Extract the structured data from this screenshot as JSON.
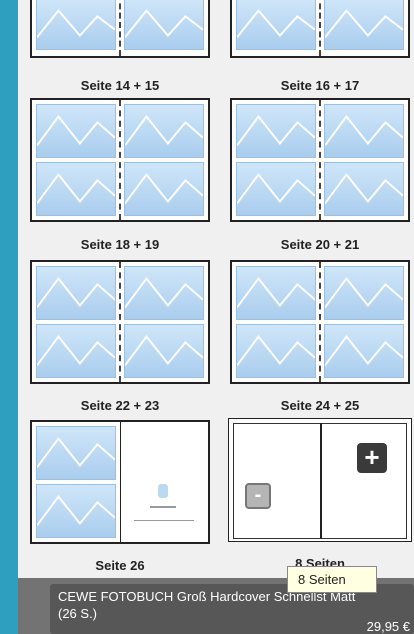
{
  "pages": [
    {
      "label": "Seite 14 + 15",
      "type": "spread-grid"
    },
    {
      "label": "Seite 16 + 17",
      "type": "spread-grid"
    },
    {
      "label": "Seite 18 + 19",
      "type": "spread-grid"
    },
    {
      "label": "Seite 20 + 21",
      "type": "spread-grid"
    },
    {
      "label": "Seite 22 + 23",
      "type": "spread-grid"
    },
    {
      "label": "Seite 24 + 25",
      "type": "spread-grid"
    },
    {
      "label": "Seite 26",
      "type": "last-page"
    },
    {
      "label": "8 Seiten",
      "type": "add-pages"
    }
  ],
  "add_pages": {
    "plus": "+",
    "minus": "-"
  },
  "tooltip": "8 Seiten",
  "product": {
    "title": "CEWE FOTOBUCH Groß Hardcover Schnellst Matt",
    "pages": "(26 S.)",
    "price": "29,95 €"
  },
  "colors": {
    "background": "#2f9fc0",
    "panel": "#f0f0f0",
    "accent_dark": "#3a3a3a"
  }
}
